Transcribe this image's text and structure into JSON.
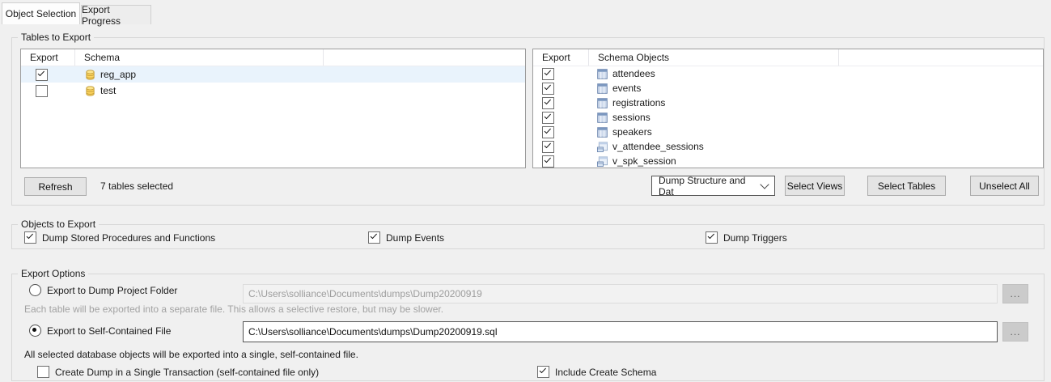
{
  "accent_colors": {
    "dialog_bg": "#f0f0f0",
    "row_highlight": "#e9f3fc",
    "schema_icon": "#fcd45e",
    "table_icon": "#7b97bf"
  },
  "tabs": [
    {
      "label": "Object Selection",
      "active": true
    },
    {
      "label": "Export Progress",
      "active": false
    }
  ],
  "tables_group": {
    "title": "Tables to Export",
    "left_list": {
      "columns": [
        "Export",
        "Schema"
      ],
      "rows": [
        {
          "name": "reg_app",
          "checked": true,
          "icon": "schema-icon",
          "selected": true
        },
        {
          "name": "test",
          "checked": false,
          "icon": "schema-icon",
          "selected": false
        }
      ]
    },
    "right_list": {
      "columns": [
        "Export",
        "Schema Objects"
      ],
      "rows": [
        {
          "name": "attendees",
          "checked": true,
          "icon": "table-icon",
          "selected": false
        },
        {
          "name": "events",
          "checked": true,
          "icon": "table-icon",
          "selected": false
        },
        {
          "name": "registrations",
          "checked": true,
          "icon": "table-icon",
          "selected": false
        },
        {
          "name": "sessions",
          "checked": true,
          "icon": "table-icon",
          "selected": false
        },
        {
          "name": "speakers",
          "checked": true,
          "icon": "table-icon",
          "selected": false
        },
        {
          "name": "v_attendee_sessions",
          "checked": true,
          "icon": "view-icon",
          "selected": false
        },
        {
          "name": "v_spk_session",
          "checked": true,
          "icon": "view-icon",
          "selected": false
        }
      ]
    },
    "refresh_button": "Refresh",
    "selected_summary": "7 tables selected",
    "dump_type_value": "Dump Structure and Dat",
    "select_views_button": "Select Views",
    "select_tables_button": "Select Tables",
    "unselect_all_button": "Unselect All"
  },
  "objects_group": {
    "title": "Objects to Export",
    "dump_procedures": {
      "label": "Dump Stored Procedures and Functions",
      "checked": true
    },
    "dump_events": {
      "label": "Dump Events",
      "checked": true
    },
    "dump_triggers": {
      "label": "Dump Triggers",
      "checked": true
    }
  },
  "export_options": {
    "title": "Export Options",
    "project_folder": {
      "radio_label": "Export to Dump Project Folder",
      "selected": false,
      "path": "C:\\Users\\solliance\\Documents\\dumps\\Dump20200919",
      "browse_label": "...",
      "note": "Each table will be exported into a separate file. This allows a selective restore, but may be slower."
    },
    "self_contained": {
      "radio_label": "Export to Self-Contained File",
      "selected": true,
      "path": "C:\\Users\\solliance\\Documents\\dumps\\Dump20200919.sql",
      "browse_label": "...",
      "note": "All selected database objects will be exported into a single, self-contained file."
    },
    "single_transaction": {
      "label": "Create Dump in a Single Transaction (self-contained file only)",
      "checked": false
    },
    "include_create_schema": {
      "label": "Include Create Schema",
      "checked": true
    }
  }
}
